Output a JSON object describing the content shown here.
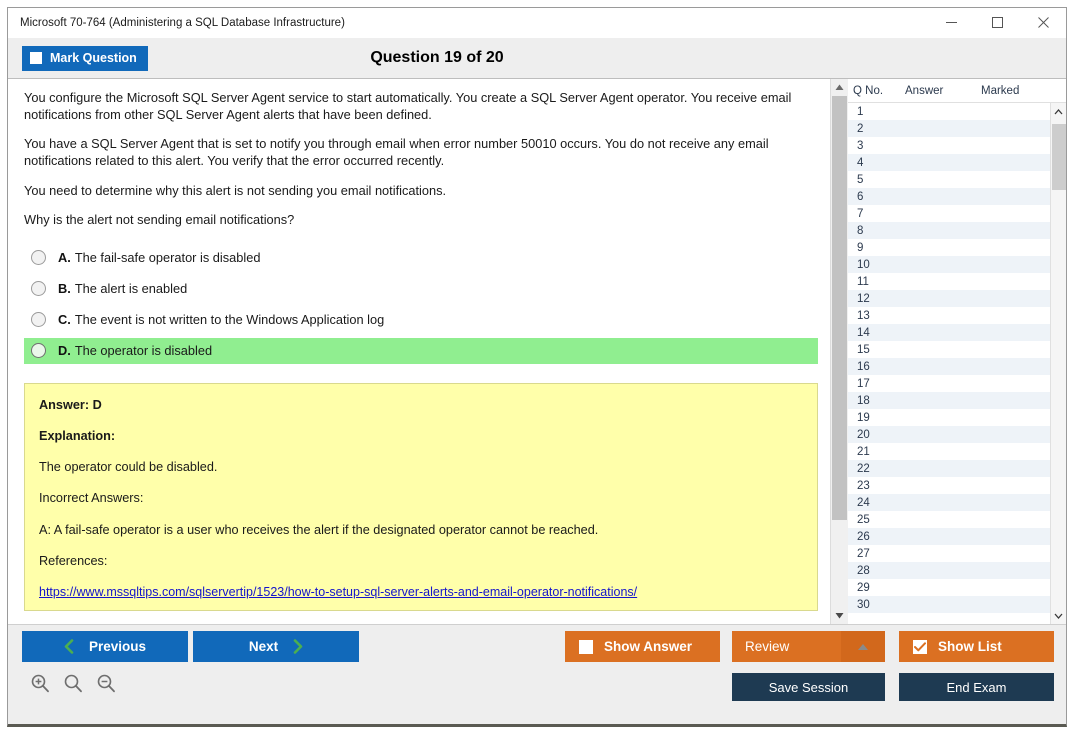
{
  "window": {
    "title": "Microsoft 70-764 (Administering a SQL Database Infrastructure)",
    "minimize_icon": "minimize-icon",
    "maximize_icon": "maximize-icon",
    "close_icon": "close-icon"
  },
  "header": {
    "mark_question_label": "Mark Question",
    "question_counter": "Question 19 of 20"
  },
  "question": {
    "paragraphs": [
      "You configure the Microsoft SQL Server Agent service to start automatically. You create a SQL Server Agent operator. You receive email notifications from other SQL Server Agent alerts that have been defined.",
      "You have a SQL Server Agent that is set to notify you through email when error number 50010 occurs. You do not receive any email notifications related to this alert. You verify that the error occurred recently.",
      "You need to determine why this alert is not sending you email notifications.",
      "Why is the alert not sending email notifications?"
    ],
    "options": [
      {
        "letter": "A.",
        "text": "The fail-safe operator is disabled",
        "correct": false
      },
      {
        "letter": "B.",
        "text": "The alert is enabled",
        "correct": false
      },
      {
        "letter": "C.",
        "text": "The event is not written to the Windows Application log",
        "correct": false
      },
      {
        "letter": "D.",
        "text": "The operator is disabled",
        "correct": true
      }
    ]
  },
  "answer_panel": {
    "answer_label": "Answer: D",
    "explanation_label": "Explanation:",
    "explanation_text": "The operator could be disabled.",
    "incorrect_label": "Incorrect Answers:",
    "incorrect_text": "A: A fail-safe operator is a user who receives the alert if the designated operator cannot be reached.",
    "references_label": "References:",
    "reference_link": "https://www.mssqltips.com/sqlservertip/1523/how-to-setup-sql-server-alerts-and-email-operator-notifications/"
  },
  "question_list": {
    "columns": [
      "Q No.",
      "Answer",
      "Marked"
    ],
    "rows": [
      {
        "qno": "1",
        "answer": "",
        "marked": ""
      },
      {
        "qno": "2",
        "answer": "",
        "marked": ""
      },
      {
        "qno": "3",
        "answer": "",
        "marked": ""
      },
      {
        "qno": "4",
        "answer": "",
        "marked": ""
      },
      {
        "qno": "5",
        "answer": "",
        "marked": ""
      },
      {
        "qno": "6",
        "answer": "",
        "marked": ""
      },
      {
        "qno": "7",
        "answer": "",
        "marked": ""
      },
      {
        "qno": "8",
        "answer": "",
        "marked": ""
      },
      {
        "qno": "9",
        "answer": "",
        "marked": ""
      },
      {
        "qno": "10",
        "answer": "",
        "marked": ""
      },
      {
        "qno": "11",
        "answer": "",
        "marked": ""
      },
      {
        "qno": "12",
        "answer": "",
        "marked": ""
      },
      {
        "qno": "13",
        "answer": "",
        "marked": ""
      },
      {
        "qno": "14",
        "answer": "",
        "marked": ""
      },
      {
        "qno": "15",
        "answer": "",
        "marked": ""
      },
      {
        "qno": "16",
        "answer": "",
        "marked": ""
      },
      {
        "qno": "17",
        "answer": "",
        "marked": ""
      },
      {
        "qno": "18",
        "answer": "",
        "marked": ""
      },
      {
        "qno": "19",
        "answer": "",
        "marked": ""
      },
      {
        "qno": "20",
        "answer": "",
        "marked": ""
      },
      {
        "qno": "21",
        "answer": "",
        "marked": ""
      },
      {
        "qno": "22",
        "answer": "",
        "marked": ""
      },
      {
        "qno": "23",
        "answer": "",
        "marked": ""
      },
      {
        "qno": "24",
        "answer": "",
        "marked": ""
      },
      {
        "qno": "25",
        "answer": "",
        "marked": ""
      },
      {
        "qno": "26",
        "answer": "",
        "marked": ""
      },
      {
        "qno": "27",
        "answer": "",
        "marked": ""
      },
      {
        "qno": "28",
        "answer": "",
        "marked": ""
      },
      {
        "qno": "29",
        "answer": "",
        "marked": ""
      },
      {
        "qno": "30",
        "answer": "",
        "marked": ""
      }
    ]
  },
  "footer": {
    "previous_label": "Previous",
    "next_label": "Next",
    "show_answer_label": "Show Answer",
    "show_answer_checked": false,
    "review_label": "Review",
    "show_list_label": "Show List",
    "show_list_checked": true,
    "save_session_label": "Save Session",
    "end_exam_label": "End Exam",
    "zoom_in_icon": "zoom-in-icon",
    "zoom_reset_icon": "zoom-reset-icon",
    "zoom_out_icon": "zoom-out-icon"
  },
  "colors": {
    "primary_blue": "#1169ba",
    "accent_orange": "#db7022",
    "navy": "#1e3a52",
    "correct_green": "#90ee90",
    "answer_yellow": "#ffffaa",
    "link_blue": "#1414cc"
  }
}
